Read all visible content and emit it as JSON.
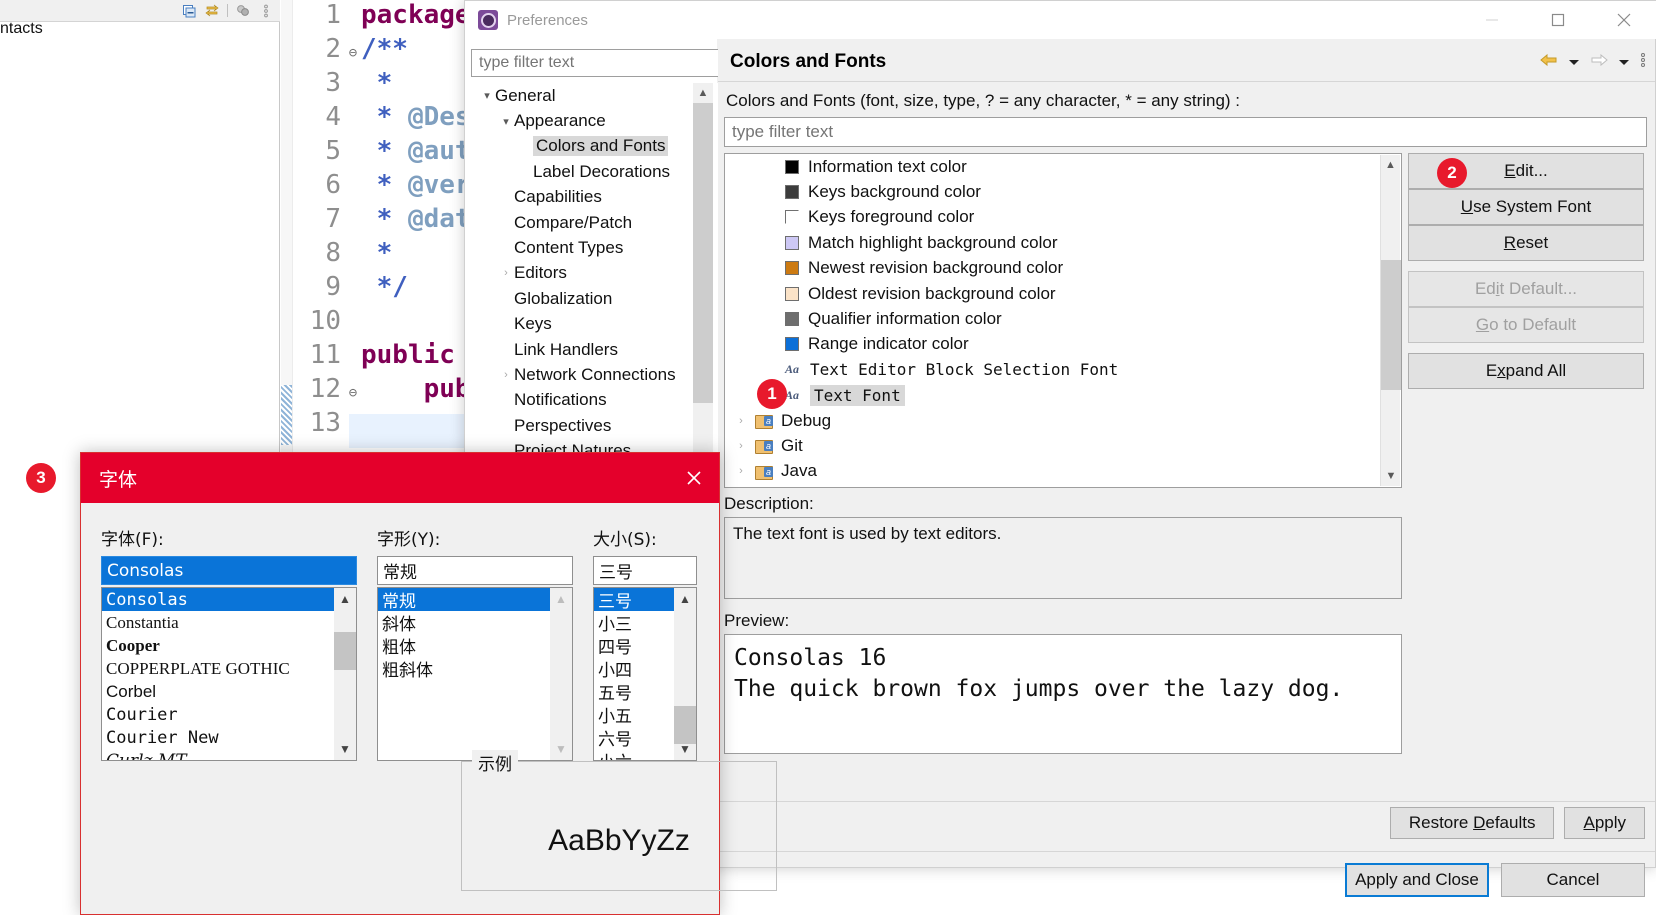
{
  "ide": {
    "left_panel_label": "ntacts",
    "toolbar_icons": [
      "collapse-all-icon",
      "link-with-editor-icon",
      "view-menu-icon",
      "view-options-icon"
    ],
    "code_lines": [
      {
        "num": "1",
        "fold": "",
        "segments": [
          {
            "t": "package",
            "c": "kw"
          }
        ]
      },
      {
        "num": "2",
        "fold": "⊖",
        "segments": [
          {
            "t": "/**",
            "c": "cmt"
          }
        ]
      },
      {
        "num": "3",
        "fold": "",
        "segments": [
          {
            "t": " *",
            "c": "cmt"
          }
        ]
      },
      {
        "num": "4",
        "fold": "",
        "segments": [
          {
            "t": " * ",
            "c": "cmt"
          },
          {
            "t": "@Desc",
            "c": "cmt-tag"
          }
        ]
      },
      {
        "num": "5",
        "fold": "",
        "segments": [
          {
            "t": " * ",
            "c": "cmt"
          },
          {
            "t": "@auth",
            "c": "cmt-tag"
          }
        ]
      },
      {
        "num": "6",
        "fold": "",
        "segments": [
          {
            "t": " * ",
            "c": "cmt"
          },
          {
            "t": "@vers",
            "c": "cmt-tag"
          }
        ]
      },
      {
        "num": "7",
        "fold": "",
        "segments": [
          {
            "t": " * ",
            "c": "cmt"
          },
          {
            "t": "@date",
            "c": "cmt-tag"
          }
        ]
      },
      {
        "num": "8",
        "fold": "",
        "segments": [
          {
            "t": " *",
            "c": "cmt"
          }
        ]
      },
      {
        "num": "9",
        "fold": "",
        "segments": [
          {
            "t": " */",
            "c": "cmt"
          }
        ]
      },
      {
        "num": "10",
        "fold": "",
        "segments": []
      },
      {
        "num": "11",
        "fold": "",
        "segments": [
          {
            "t": "public c",
            "c": "kw"
          }
        ]
      },
      {
        "num": "12",
        "fold": "⊖",
        "segments": [
          {
            "t": "    publ",
            "c": "kw"
          }
        ]
      },
      {
        "num": "13",
        "fold": "",
        "segments": []
      }
    ]
  },
  "preferences": {
    "title": "Preferences",
    "icon": "preferences-gear-icon",
    "window_buttons": [
      "minimize-icon",
      "maximize-icon",
      "close-icon"
    ],
    "tree_filter_placeholder": "type filter text",
    "tree": [
      {
        "label": "General",
        "indent": 0,
        "arrow": "expanded",
        "selected": false
      },
      {
        "label": "Appearance",
        "indent": 1,
        "arrow": "expanded",
        "selected": false
      },
      {
        "label": "Colors and Fonts",
        "indent": 2,
        "arrow": "none",
        "selected": true
      },
      {
        "label": "Label Decorations",
        "indent": 2,
        "arrow": "none",
        "selected": false
      },
      {
        "label": "Capabilities",
        "indent": 1,
        "arrow": "none",
        "selected": false
      },
      {
        "label": "Compare/Patch",
        "indent": 1,
        "arrow": "none",
        "selected": false
      },
      {
        "label": "Content Types",
        "indent": 1,
        "arrow": "none",
        "selected": false
      },
      {
        "label": "Editors",
        "indent": 1,
        "arrow": "collapsed",
        "selected": false
      },
      {
        "label": "Globalization",
        "indent": 1,
        "arrow": "none",
        "selected": false
      },
      {
        "label": "Keys",
        "indent": 1,
        "arrow": "none",
        "selected": false
      },
      {
        "label": "Link Handlers",
        "indent": 1,
        "arrow": "none",
        "selected": false
      },
      {
        "label": "Network Connections",
        "indent": 1,
        "arrow": "collapsed",
        "selected": false
      },
      {
        "label": "Notifications",
        "indent": 1,
        "arrow": "none",
        "selected": false
      },
      {
        "label": "Perspectives",
        "indent": 1,
        "arrow": "none",
        "selected": false
      },
      {
        "label": "Project Natures",
        "indent": 1,
        "arrow": "none",
        "selected": false
      }
    ],
    "page": {
      "title": "Colors and Fonts",
      "nav_icons": [
        "back-arrow-icon",
        "back-dropdown-icon",
        "forward-arrow-icon",
        "forward-dropdown-icon",
        "view-menu-icon"
      ],
      "filter_label": "Colors and Fonts (font, size, type, ? = any character, * = any string) :",
      "filter_placeholder": "type filter text",
      "items": [
        {
          "label": "Information text color",
          "kind": "color",
          "color": "#000000",
          "selected": false,
          "arrow": "none"
        },
        {
          "label": "Keys background color",
          "kind": "color",
          "color": "#3c3c3c",
          "selected": false,
          "arrow": "none"
        },
        {
          "label": "Keys foreground color",
          "kind": "color",
          "color": "#ffffff",
          "selected": false,
          "arrow": "none"
        },
        {
          "label": "Match highlight background color",
          "kind": "color",
          "color": "#cdc8f5",
          "selected": false,
          "arrow": "none"
        },
        {
          "label": "Newest revision background color",
          "kind": "color",
          "color": "#cc7a12",
          "selected": false,
          "arrow": "none"
        },
        {
          "label": "Oldest revision background color",
          "kind": "color",
          "color": "#fbe3c8",
          "selected": false,
          "arrow": "none"
        },
        {
          "label": "Qualifier information color",
          "kind": "color",
          "color": "#6e6e6e",
          "selected": false,
          "arrow": "none"
        },
        {
          "label": "Range indicator color",
          "kind": "color",
          "color": "#0b6fd8",
          "selected": false,
          "arrow": "none"
        },
        {
          "label": "Text Editor Block Selection Font",
          "kind": "font",
          "selected": false,
          "arrow": "none"
        },
        {
          "label": "Text Font",
          "kind": "font",
          "selected": true,
          "arrow": "none"
        },
        {
          "label": "Debug",
          "kind": "folder",
          "selected": false,
          "arrow": "collapsed"
        },
        {
          "label": "Git",
          "kind": "folder",
          "selected": false,
          "arrow": "collapsed"
        },
        {
          "label": "Java",
          "kind": "folder",
          "selected": false,
          "arrow": "collapsed"
        }
      ],
      "side_buttons": [
        {
          "label": "Edit...",
          "accel": "E",
          "enabled": true
        },
        {
          "label": "Use System Font",
          "accel": "U",
          "enabled": true
        },
        {
          "label": "Reset",
          "accel": "R",
          "enabled": true
        },
        {
          "label": "Edit Default...",
          "accel": "i",
          "enabled": false
        },
        {
          "label": "Go to Default",
          "accel": "G",
          "enabled": false
        },
        {
          "label": "Expand All",
          "accel": "x",
          "enabled": true
        }
      ],
      "description_label": "Description:",
      "description_text": "The text font is used by text editors.",
      "preview_label": "Preview:",
      "preview_line1": "Consolas 16",
      "preview_line2": "The quick brown fox jumps over the lazy dog."
    },
    "bottom_buttons": [
      {
        "label": "Restore Defaults",
        "accel": "D"
      },
      {
        "label": "Apply",
        "accel": "A"
      }
    ],
    "footer_buttons": [
      {
        "label": "Apply and Close",
        "primary": true
      },
      {
        "label": "Cancel",
        "primary": false
      }
    ]
  },
  "font_dialog": {
    "title": "字体",
    "close_icon": "close-icon",
    "font_label": "字体(F):",
    "font_value": "Consolas",
    "font_items": [
      {
        "label": "Consolas",
        "style": "mono",
        "selected": true
      },
      {
        "label": "Constantia",
        "style": "serif",
        "selected": false
      },
      {
        "label": "Cooper",
        "style": "bold",
        "selected": false
      },
      {
        "label": "COPPERPLATE GOTHIC",
        "style": "smallcaps",
        "selected": false
      },
      {
        "label": "Corbel",
        "style": "sans",
        "selected": false
      },
      {
        "label": "Courier",
        "style": "mono",
        "selected": false
      },
      {
        "label": "Courier New",
        "style": "mono",
        "selected": false
      },
      {
        "label": "Curlz MT",
        "style": "script",
        "selected": false
      }
    ],
    "style_label": "字形(Y):",
    "style_value": "常规",
    "style_items": [
      {
        "label": "常规",
        "selected": true
      },
      {
        "label": "斜体",
        "selected": false
      },
      {
        "label": "粗体",
        "selected": false
      },
      {
        "label": "粗斜体",
        "selected": false
      }
    ],
    "size_label": "大小(S):",
    "size_value": "三号",
    "size_items": [
      {
        "label": "三号",
        "selected": true
      },
      {
        "label": "小三",
        "selected": false
      },
      {
        "label": "四号",
        "selected": false
      },
      {
        "label": "小四",
        "selected": false
      },
      {
        "label": "五号",
        "selected": false
      },
      {
        "label": "小五",
        "selected": false
      },
      {
        "label": "六号",
        "selected": false
      },
      {
        "label": "小六",
        "selected": false
      }
    ],
    "sample_legend": "示例",
    "sample_text": "AaBbYyZz"
  },
  "badges": [
    {
      "n": "1",
      "target": "text-font-list-item"
    },
    {
      "n": "2",
      "target": "edit-button"
    },
    {
      "n": "3",
      "target": "font-dialog"
    }
  ],
  "colors": {
    "accent_red": "#e4002b",
    "badge_red": "#e8192c",
    "selection_blue": "#0a74d8",
    "focus_blue": "#0a7bd4",
    "window_bg": "#f0f0f0"
  }
}
